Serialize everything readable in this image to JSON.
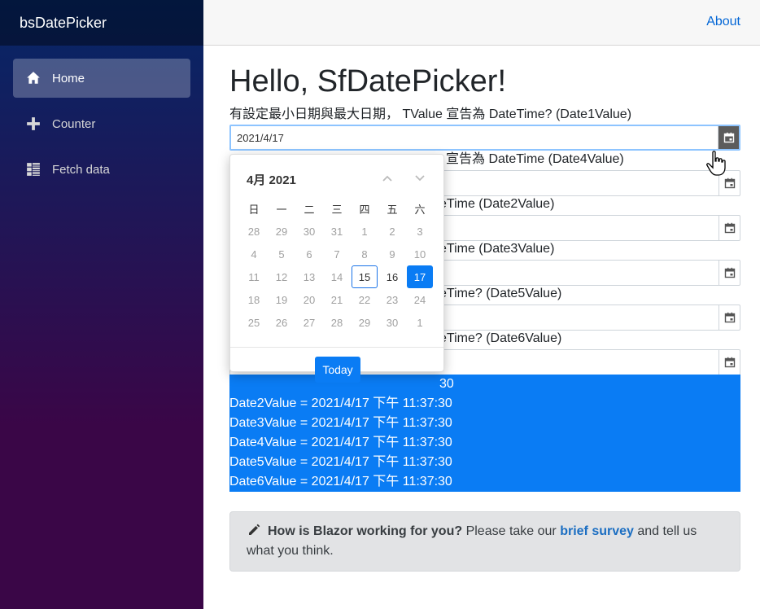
{
  "brand": "bsDatePicker",
  "nav": [
    {
      "label": "Home",
      "icon": "home-icon",
      "active": true
    },
    {
      "label": "Counter",
      "icon": "plus-icon"
    },
    {
      "label": "Fetch data",
      "icon": "list-icon"
    }
  ],
  "top": {
    "about": "About"
  },
  "page_title": "Hello, SfDatePicker!",
  "fields": [
    {
      "label": "有設定最小日期與最大日期， TValue 宣告為 DateTime? (Date1Value)",
      "value": "2021/4/17"
    },
    {
      "label": "宣告為 DateTime (Date4Value)",
      "value": ""
    },
    {
      "label": "eTime (Date2Value)",
      "value": ""
    },
    {
      "label": "eTime (Date3Value)",
      "value": ""
    },
    {
      "label": "eTime? (Date5Value)",
      "value": ""
    },
    {
      "label": "eTime? (Date6Value)",
      "value": ""
    }
  ],
  "results": [
    "30",
    "Date2Value = 2021/4/17 下午 11:37:30",
    "Date3Value = 2021/4/17 下午 11:37:30",
    "Date4Value = 2021/4/17 下午 11:37:30",
    "Date5Value = 2021/4/17 下午 11:37:30",
    "Date6Value = 2021/4/17 下午 11:37:30"
  ],
  "survey": {
    "lead": "How is Blazor working for you?",
    "text1": " Please take our ",
    "link": "brief survey",
    "text2": " and tell us what you think."
  },
  "calendar": {
    "header": "4月 2021",
    "weekdays": [
      "日",
      "一",
      "二",
      "三",
      "四",
      "五",
      "六"
    ],
    "weeks": [
      [
        "28",
        "29",
        "30",
        "31",
        "1",
        "2",
        "3"
      ],
      [
        "4",
        "5",
        "6",
        "7",
        "8",
        "9",
        "10"
      ],
      [
        "11",
        "12",
        "13",
        "14",
        "15",
        "16",
        "17"
      ],
      [
        "18",
        "19",
        "20",
        "21",
        "22",
        "23",
        "24"
      ],
      [
        "25",
        "26",
        "27",
        "28",
        "29",
        "30",
        "1"
      ]
    ],
    "today_label": "Today",
    "today_day": "15",
    "selected_day": "17"
  },
  "colors": {
    "accent": "#0a7cf4",
    "link": "#0366d6"
  }
}
